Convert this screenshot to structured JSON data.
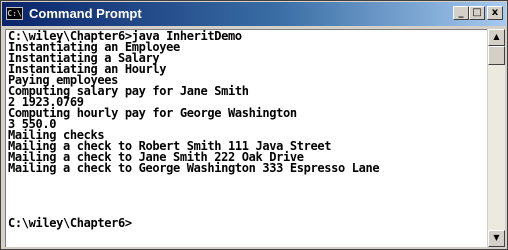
{
  "window": {
    "title": "Command Prompt",
    "icon": "cmd-icon",
    "icon_glyph": "C:\\",
    "buttons": {
      "minimize": "_",
      "maximize": "□",
      "close": "x"
    }
  },
  "console": {
    "lines": [
      "C:\\wiley\\Chapter6>java InheritDemo",
      "Instantiating an Employee",
      "Instantiating a Salary",
      "Instantiating an Hourly",
      "Paying employees",
      "Computing salary pay for Jane Smith",
      "2 1923.0769",
      "Computing hourly pay for George Washington",
      "3 550.0",
      "Mailing checks",
      "Mailing a check to Robert Smith 111 Java Street",
      "Mailing a check to Jane Smith 222 Oak Drive",
      "Mailing a check to George Washington 333 Espresso Lane",
      "",
      "",
      "",
      "",
      "C:\\wiley\\Chapter6>"
    ]
  },
  "scrollbar": {
    "up_glyph": "▲",
    "down_glyph": "▼"
  },
  "colors": {
    "titlebar": "#0a246a",
    "background": "#ffffff",
    "text": "#000000"
  }
}
